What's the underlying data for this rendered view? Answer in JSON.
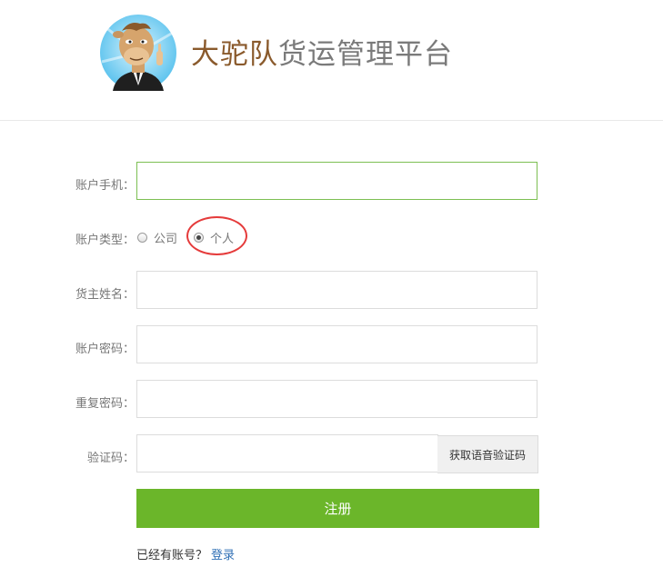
{
  "header": {
    "brand": "大驼队",
    "title_rest": "货运管理平台"
  },
  "form": {
    "phone_label": "账户手机：",
    "type_label": "账户类型：",
    "type_options": [
      "公司",
      "个人"
    ],
    "type_selected": "个人",
    "name_label": "货主姓名：",
    "password_label": "账户密码：",
    "repeat_label": "重复密码：",
    "code_label": "验证码：",
    "voice_code_button": "获取语音验证码",
    "submit_label": "注册",
    "has_account_text": "已经有账号？",
    "login_link": "登录"
  },
  "colors": {
    "brand": "#8a5a2c",
    "submit_bg": "#6bb62a",
    "focus_border": "#7cbf52",
    "annotation": "#e53b3b",
    "link": "#2f6fb5"
  },
  "icons": [
    "camel-logo-icon"
  ]
}
